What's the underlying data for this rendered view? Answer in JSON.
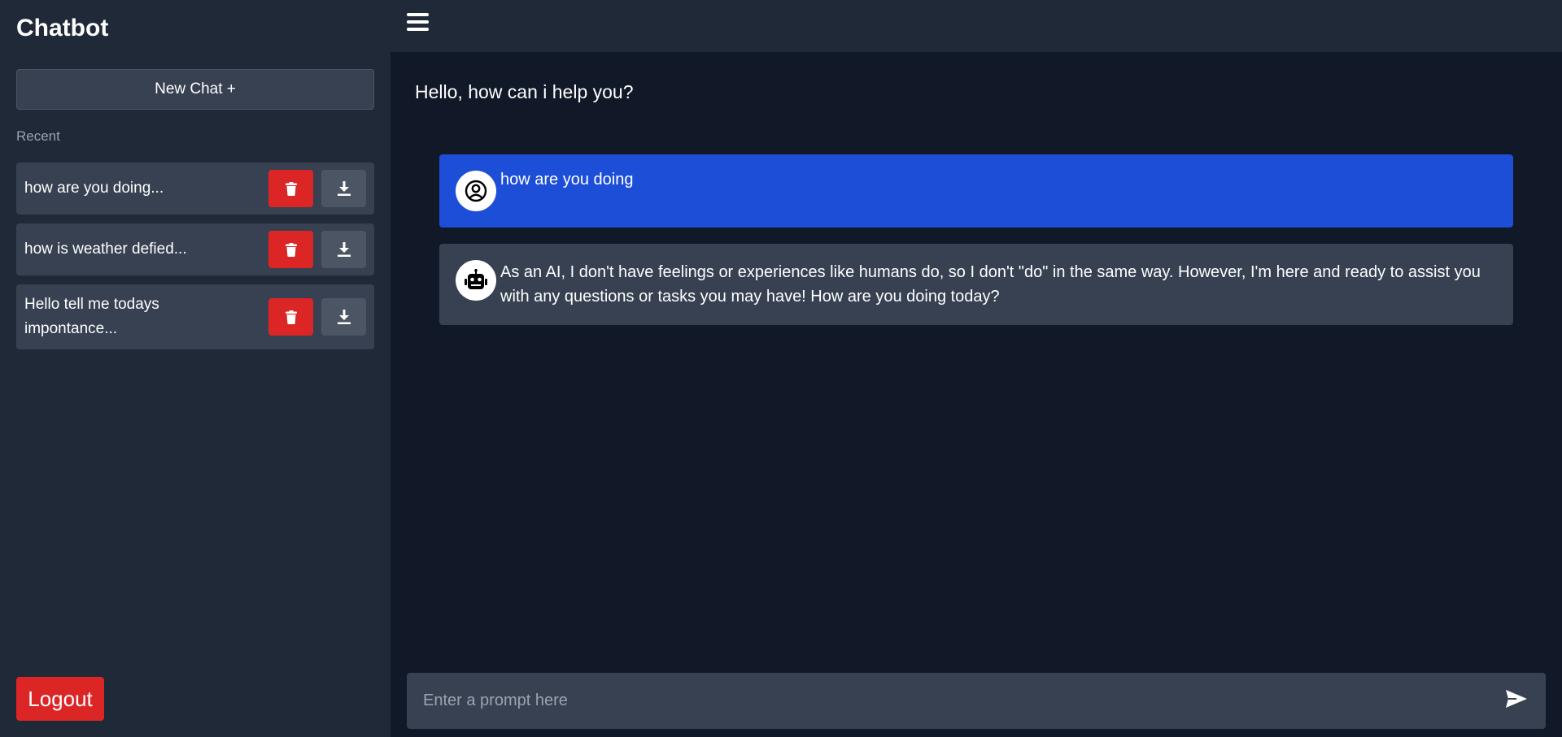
{
  "app": {
    "title": "Chatbot"
  },
  "sidebar": {
    "new_chat_label": "New Chat +",
    "recent_label": "Recent",
    "chats": [
      {
        "title": "how are you doing..."
      },
      {
        "title": "how is weather defied..."
      },
      {
        "title": "Hello tell me todays impontance..."
      }
    ],
    "logout_label": "Logout"
  },
  "main": {
    "greeting": "Hello, how can i help you?",
    "messages": [
      {
        "role": "user",
        "text": "how are you doing"
      },
      {
        "role": "bot",
        "text": "As an AI, I don't have feelings or experiences like humans do, so I don't \"do\" in the same way. However, I'm here and ready to assist you with any questions or tasks you may have! How are you doing today?"
      }
    ],
    "prompt": {
      "placeholder": "Enter a prompt here",
      "value": ""
    }
  },
  "icons": {
    "menu": "menu-icon",
    "delete": "trash-icon",
    "download": "download-icon",
    "user_avatar": "user-circle-icon",
    "bot_avatar": "robot-icon",
    "send": "send-icon"
  },
  "colors": {
    "sidebar_bg": "#1f2937",
    "main_bg": "#111827",
    "user_message": "#1d4ed8",
    "bot_message": "#374151",
    "danger": "#dc2626"
  }
}
